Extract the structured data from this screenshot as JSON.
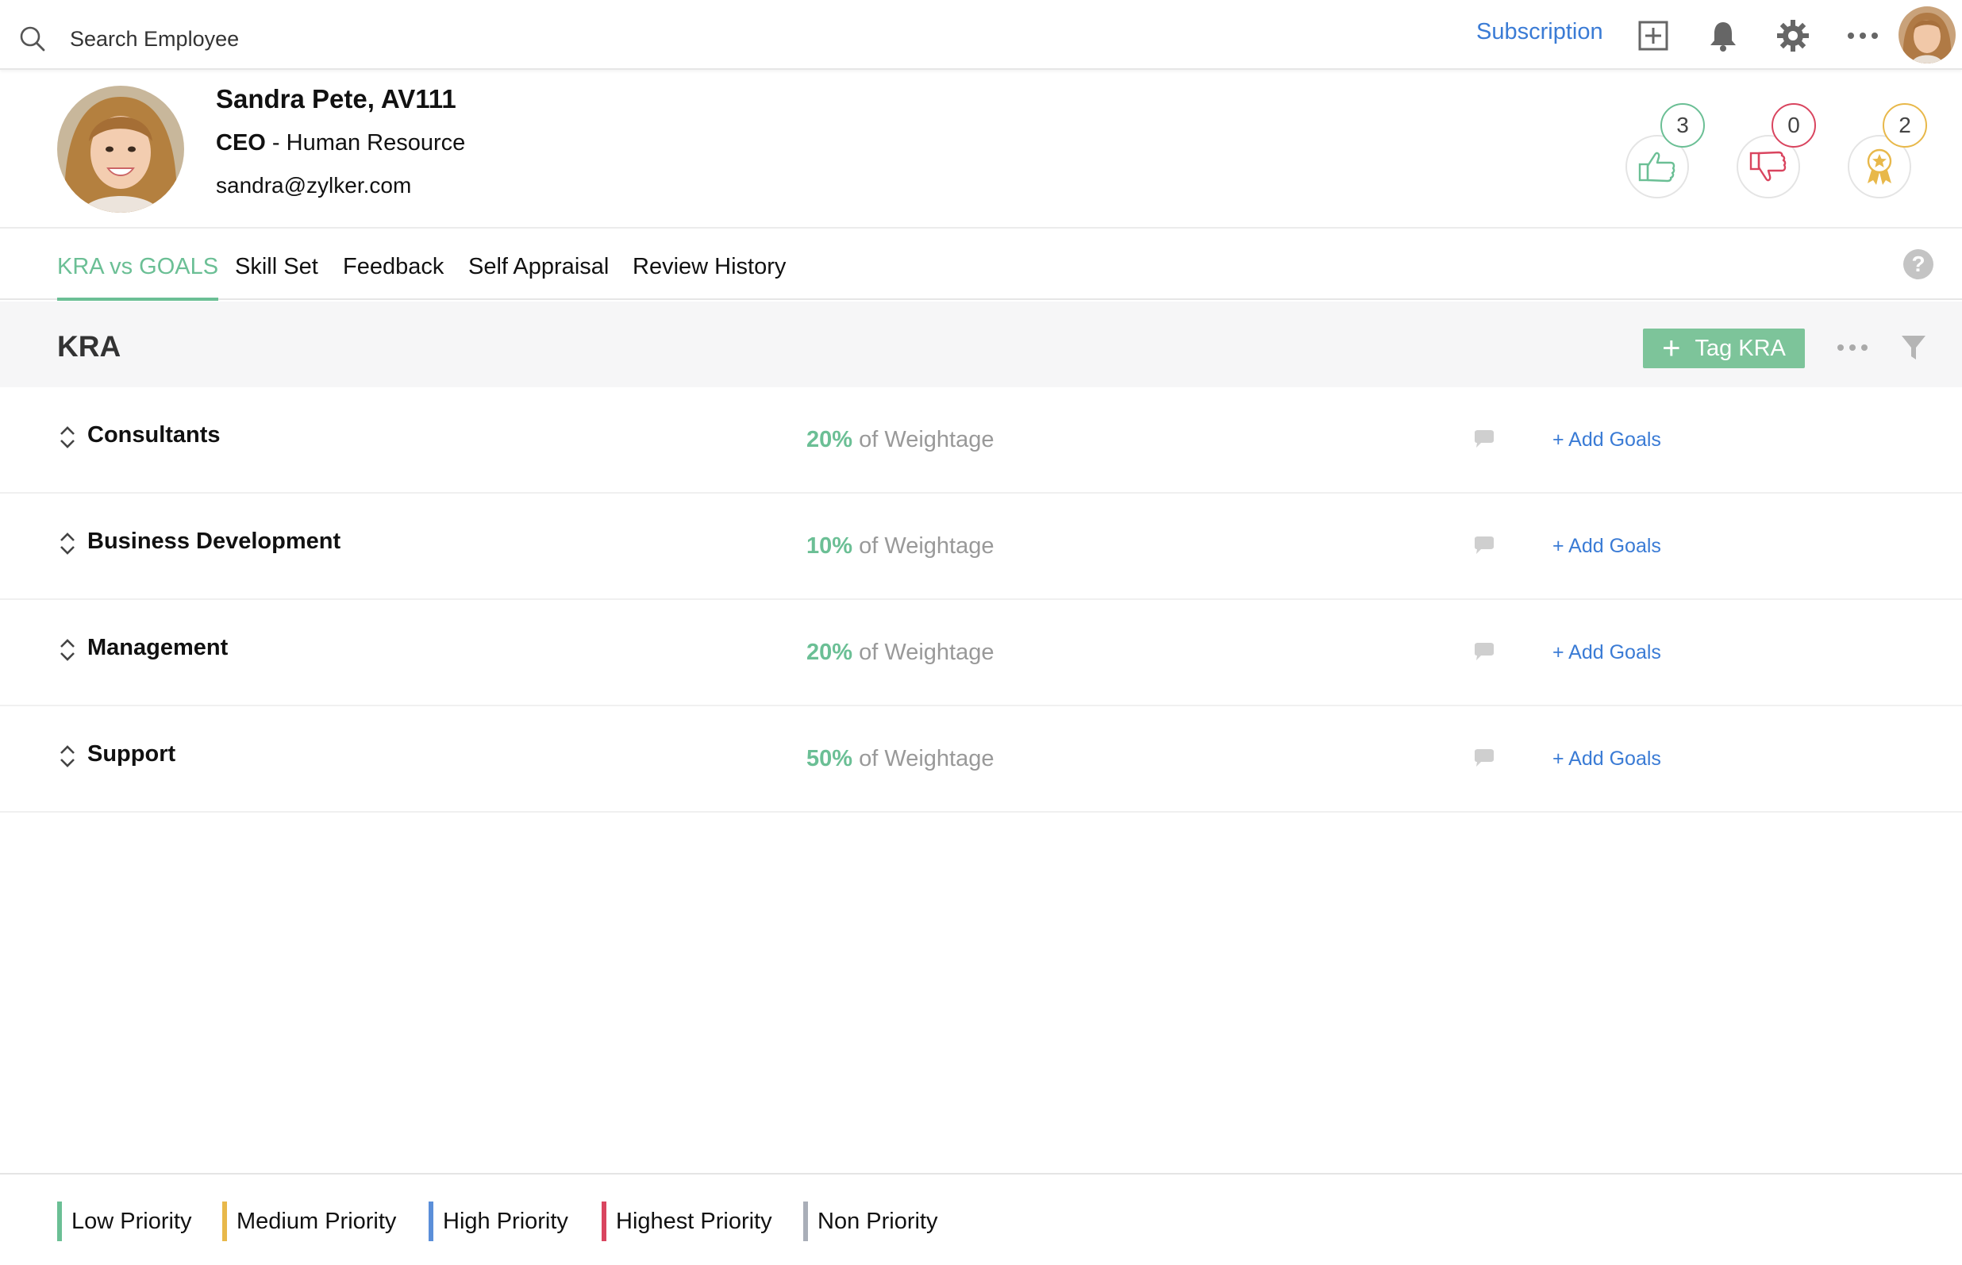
{
  "topbar": {
    "search_placeholder": "Search Employee",
    "subscription_label": "Subscription",
    "icons": [
      "search-icon",
      "add-box-icon",
      "bell-icon",
      "gear-icon",
      "more-icon"
    ]
  },
  "profile": {
    "name": "Sandra Pete, AV111",
    "designation": "CEO",
    "role_separator": " - ",
    "department": "Human Resource",
    "email": "sandra@zylker.com",
    "badges": [
      {
        "name": "likes",
        "count": "3",
        "color": "#6bbf95"
      },
      {
        "name": "dislikes",
        "count": "0",
        "color": "#d9455f"
      },
      {
        "name": "awards",
        "count": "2",
        "color": "#e8b84a"
      }
    ]
  },
  "tabs": [
    {
      "label": "KRA vs GOALS",
      "active": true
    },
    {
      "label": "Skill Set",
      "active": false
    },
    {
      "label": "Feedback",
      "active": false
    },
    {
      "label": "Self Appraisal",
      "active": false
    },
    {
      "label": "Review History",
      "active": false
    }
  ],
  "kra_section": {
    "title": "KRA",
    "tag_button_label": "Tag KRA",
    "weight_suffix": "of Weightage",
    "add_goals_label": "+ Add Goals",
    "rows": [
      {
        "name": "Consultants",
        "weight": "20%"
      },
      {
        "name": "Business Development",
        "weight": "10%"
      },
      {
        "name": "Management",
        "weight": "20%"
      },
      {
        "name": "Support",
        "weight": "50%"
      }
    ]
  },
  "legend": [
    {
      "label": "Low Priority",
      "color": "#6bbf95"
    },
    {
      "label": "Medium Priority",
      "color": "#e8b84a"
    },
    {
      "label": "High Priority",
      "color": "#5b8fd9"
    },
    {
      "label": "Highest Priority",
      "color": "#d9455f"
    },
    {
      "label": "Non Priority",
      "color": "#a9aeb8"
    }
  ]
}
